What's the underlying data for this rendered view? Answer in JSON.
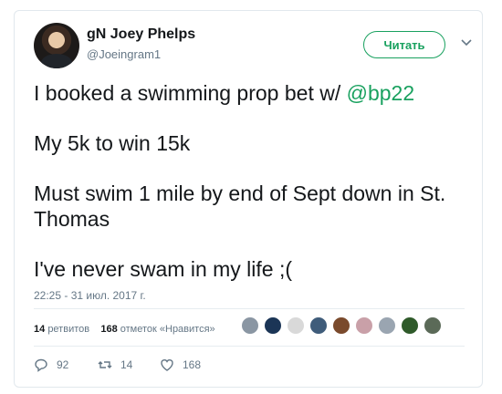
{
  "author": {
    "name": "gN Joey Phelps",
    "handle": "@Joeingram1"
  },
  "follow_button": "Читать",
  "tweet": {
    "line1_text": "I booked a swimming prop bet w/ ",
    "line1_mention": "@bp22",
    "line2": "My 5k to win 15k",
    "line3": "Must swim 1 mile by end of Sept down in St. Thomas",
    "line4": "I've never swam in my life ;("
  },
  "timestamp": "22:25 - 31 июл. 2017 г.",
  "stats": {
    "retweets_count": "14",
    "retweets_label": "ретвитов",
    "likes_count": "168",
    "likes_label": "отметок «Нравится»"
  },
  "facepile_colors": [
    "#8a96a3",
    "#1b3556",
    "#d9d9d9",
    "#3f5c7a",
    "#7a4a2c",
    "#c9a0a8",
    "#9aa5b1",
    "#2f5a2a",
    "#5b6a58"
  ],
  "actions": {
    "replies": "92",
    "retweets": "14",
    "likes": "168"
  },
  "colors": {
    "accent": "#19a15f",
    "muted": "#657786"
  }
}
